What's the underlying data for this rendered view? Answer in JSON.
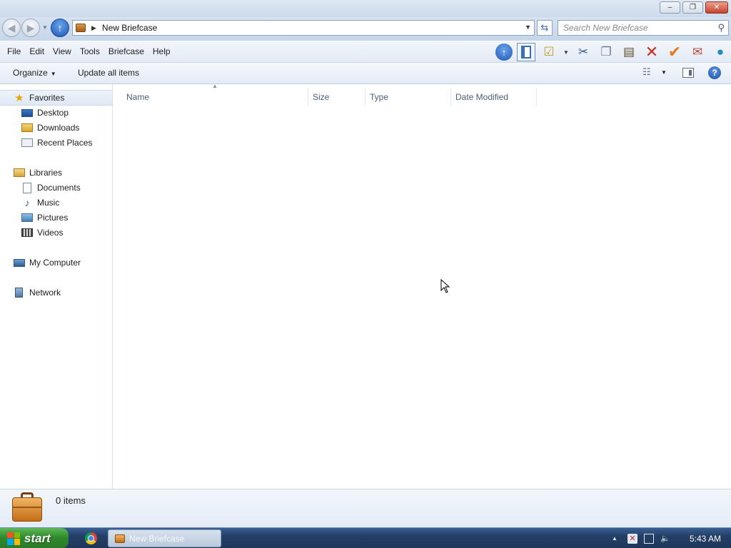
{
  "window": {
    "minimize_glyph": "–",
    "restore_glyph": "❐",
    "close_glyph": "✕"
  },
  "nav": {
    "address": "New Briefcase",
    "search_placeholder": "Search New Briefcase"
  },
  "menu": {
    "items": [
      "File",
      "Edit",
      "View",
      "Tools",
      "Briefcase",
      "Help"
    ]
  },
  "toolbar_icons": [
    "up-icon",
    "folders-pane-icon",
    "sync-icon",
    "scissors-icon",
    "copy-icon",
    "paste-icon",
    "delete-icon",
    "check-icon",
    "email-icon",
    "globe-icon"
  ],
  "command_bar": {
    "organize": "Organize",
    "update_all": "Update all items"
  },
  "navpane": {
    "favorites": "Favorites",
    "desktop": "Desktop",
    "downloads": "Downloads",
    "recent_places": "Recent Places",
    "libraries": "Libraries",
    "documents": "Documents",
    "music": "Music",
    "pictures": "Pictures",
    "videos": "Videos",
    "my_computer": "My Computer",
    "network": "Network"
  },
  "columns": {
    "name": "Name",
    "size": "Size",
    "type": "Type",
    "date_modified": "Date Modified"
  },
  "details": {
    "item_count": "0 items"
  },
  "taskbar": {
    "start": "start",
    "window_button": "New Briefcase",
    "clock": "5:43 AM"
  },
  "colors": {
    "titlebar": "#ccdaeb",
    "start_green": "#2f8a2b",
    "taskbar": "#243f67",
    "accent_blue": "#1f56b8"
  }
}
